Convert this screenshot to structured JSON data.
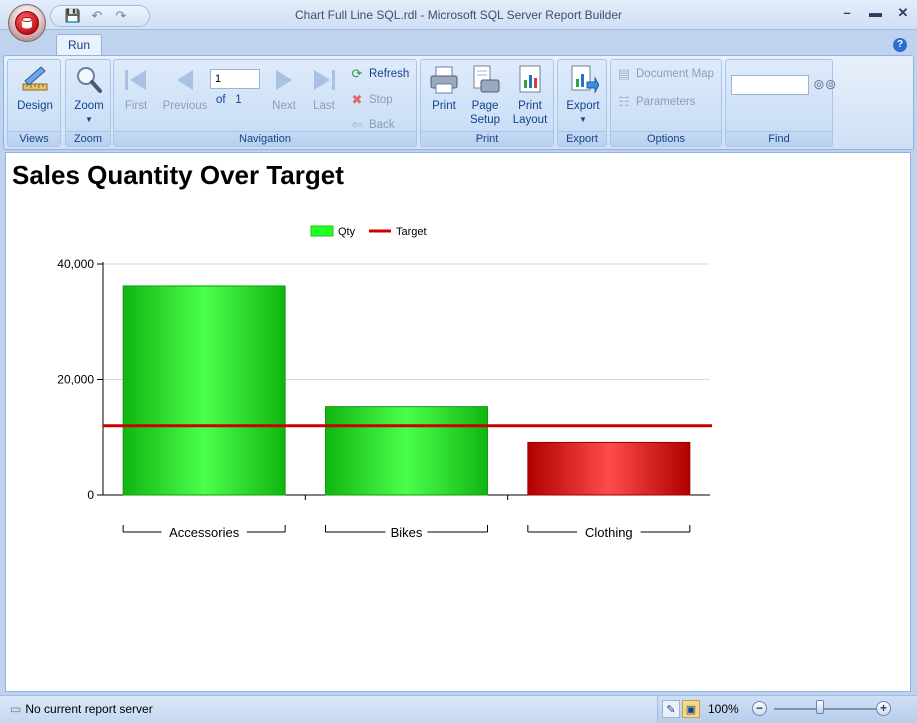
{
  "window": {
    "title": "Chart Full Line SQL.rdl - Microsoft SQL Server Report Builder",
    "minimize": "–",
    "maximize": "▬",
    "close": "✕"
  },
  "tabs": [
    {
      "label": "Run",
      "active": true
    }
  ],
  "help": "?",
  "ribbon": {
    "views": {
      "label": "Views",
      "design": "Design"
    },
    "zoom": {
      "label": "Zoom",
      "zoom": "Zoom"
    },
    "navigation": {
      "label": "Navigation",
      "first": "First",
      "previous": "Previous",
      "page_value": "1",
      "of": "of",
      "total_pages": "1",
      "next": "Next",
      "last": "Last",
      "refresh": "Refresh",
      "stop": "Stop",
      "back": "Back"
    },
    "print": {
      "label": "Print",
      "print": "Print",
      "page_setup_1": "Page",
      "page_setup_2": "Setup",
      "print_layout_1": "Print",
      "print_layout_2": "Layout"
    },
    "export": {
      "label": "Export",
      "export": "Export"
    },
    "options": {
      "label": "Options",
      "document_map": "Document Map",
      "parameters": "Parameters"
    },
    "find": {
      "label": "Find",
      "value": ""
    }
  },
  "report": {
    "title": "Sales Quantity Over Target"
  },
  "chart_data": {
    "type": "bar",
    "categories": [
      "Accessories",
      "Bikes",
      "Clothing"
    ],
    "series": [
      {
        "name": "Qty",
        "values": [
          36200,
          15300,
          9100
        ],
        "colors": [
          "#22dd22",
          "#22dd22",
          "#cc1111"
        ]
      },
      {
        "name": "Target",
        "type": "line",
        "value": 12000,
        "color": "#cc0000"
      }
    ],
    "ylim": [
      0,
      40000
    ],
    "yticks": [
      0,
      20000,
      40000
    ],
    "ytick_labels": [
      "0",
      "20,000",
      "40,000"
    ],
    "legend": "top-center",
    "grid": true
  },
  "status": {
    "text": "No current report server",
    "zoom": "100%",
    "zoom_out": "−",
    "zoom_in": "+"
  }
}
